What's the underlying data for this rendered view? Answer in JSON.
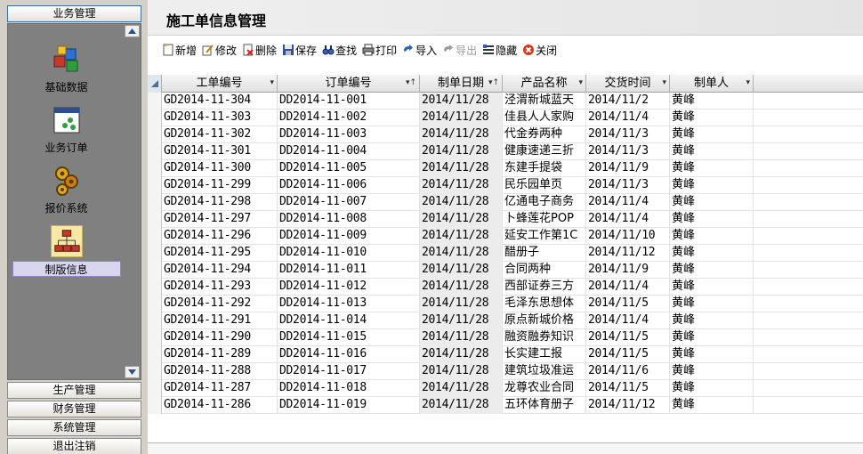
{
  "sidebar": {
    "groups": {
      "business": "业务管理",
      "production": "生产管理",
      "finance": "财务管理",
      "system": "系统管理",
      "logout": "退出注销"
    },
    "items": [
      {
        "label": "基础数据",
        "icon": "cube-cluster-icon"
      },
      {
        "label": "业务订单",
        "icon": "order-window-icon"
      },
      {
        "label": "报价系统",
        "icon": "gears-icon"
      },
      {
        "label": "制版信息",
        "icon": "org-chart-icon",
        "selected": true
      }
    ]
  },
  "main": {
    "title": "施工单信息管理",
    "toolbar": {
      "add": "新增",
      "edit": "修改",
      "delete": "删除",
      "save": "保存",
      "find": "查找",
      "print": "打印",
      "import": "导入",
      "export": "导出",
      "hide": "隐藏",
      "close": "关闭"
    },
    "grid": {
      "columns": [
        "工单编号",
        "订单编号",
        "制单日期",
        "产品名称",
        "交货时间",
        "制单人"
      ],
      "rows": [
        [
          "GD2014-11-304",
          "DD2014-11-001",
          "2014/11/28",
          "泾渭新城蓝天",
          "2014/11/2",
          "黄峰"
        ],
        [
          "GD2014-11-303",
          "DD2014-11-002",
          "2014/11/28",
          "佳县人人家购",
          "2014/11/4",
          "黄峰"
        ],
        [
          "GD2014-11-302",
          "DD2014-11-003",
          "2014/11/28",
          "代金券两种",
          "2014/11/3",
          "黄峰"
        ],
        [
          "GD2014-11-301",
          "DD2014-11-004",
          "2014/11/28",
          "健康速递三折",
          "2014/11/3",
          "黄峰"
        ],
        [
          "GD2014-11-300",
          "DD2014-11-005",
          "2014/11/28",
          "东建手提袋",
          "2014/11/9",
          "黄峰"
        ],
        [
          "GD2014-11-299",
          "DD2014-11-006",
          "2014/11/28",
          "民乐园单页",
          "2014/11/3",
          "黄峰"
        ],
        [
          "GD2014-11-298",
          "DD2014-11-007",
          "2014/11/28",
          "亿通电子商务",
          "2014/11/4",
          "黄峰"
        ],
        [
          "GD2014-11-297",
          "DD2014-11-008",
          "2014/11/28",
          "卜蜂莲花POP",
          "2014/11/4",
          "黄峰"
        ],
        [
          "GD2014-11-296",
          "DD2014-11-009",
          "2014/11/28",
          "延安工作第1C",
          "2014/11/10",
          "黄峰"
        ],
        [
          "GD2014-11-295",
          "DD2014-11-010",
          "2014/11/28",
          "醋册子",
          "2014/11/12",
          "黄峰"
        ],
        [
          "GD2014-11-294",
          "DD2014-11-011",
          "2014/11/28",
          "合同两种",
          "2014/11/9",
          "黄峰"
        ],
        [
          "GD2014-11-293",
          "DD2014-11-012",
          "2014/11/28",
          "西部证券三方",
          "2014/11/4",
          "黄峰"
        ],
        [
          "GD2014-11-292",
          "DD2014-11-013",
          "2014/11/28",
          "毛泽东思想体",
          "2014/11/5",
          "黄峰"
        ],
        [
          "GD2014-11-291",
          "DD2014-11-014",
          "2014/11/28",
          "原点新城价格",
          "2014/11/4",
          "黄峰"
        ],
        [
          "GD2014-11-290",
          "DD2014-11-015",
          "2014/11/28",
          "融资融券知识",
          "2014/11/5",
          "黄峰"
        ],
        [
          "GD2014-11-289",
          "DD2014-11-016",
          "2014/11/28",
          "长实建工报",
          "2014/11/5",
          "黄峰"
        ],
        [
          "GD2014-11-288",
          "DD2014-11-017",
          "2014/11/28",
          "建筑垃圾准运",
          "2014/11/6",
          "黄峰"
        ],
        [
          "GD2014-11-287",
          "DD2014-11-018",
          "2014/11/28",
          "龙尊农业合同",
          "2014/11/5",
          "黄峰"
        ],
        [
          "GD2014-11-286",
          "DD2014-11-019",
          "2014/11/28",
          "五环体育册子",
          "2014/11/12",
          "黄峰"
        ]
      ]
    }
  }
}
